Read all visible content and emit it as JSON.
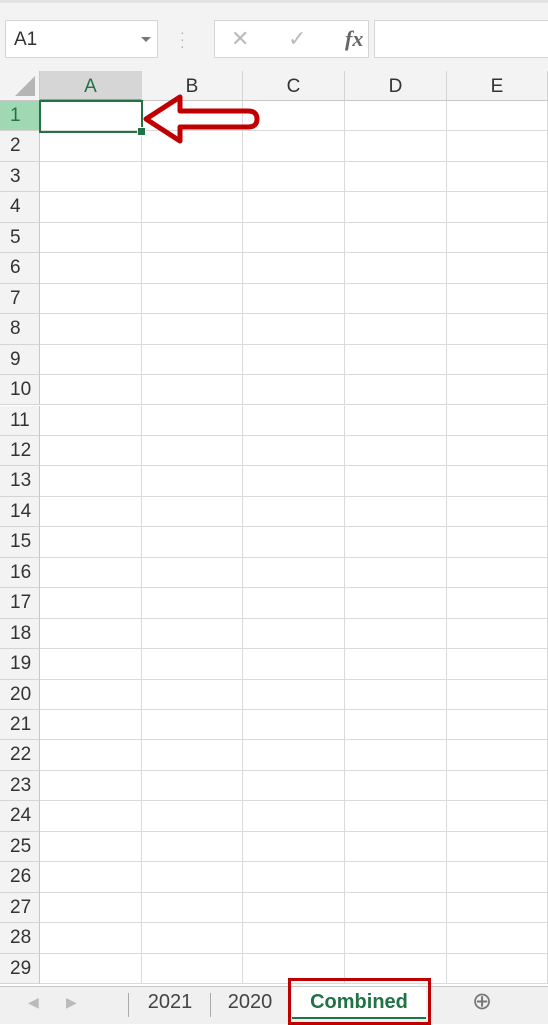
{
  "name_box": {
    "value": "A1"
  },
  "formula_bar": {
    "cancel_icon": "✕",
    "enter_icon": "✓",
    "fx_label": "fx",
    "value": ""
  },
  "columns": [
    "A",
    "B",
    "C",
    "D",
    "E"
  ],
  "rows": [
    "1",
    "2",
    "3",
    "4",
    "5",
    "6",
    "7",
    "8",
    "9",
    "10",
    "11",
    "12",
    "13",
    "14",
    "15",
    "16",
    "17",
    "18",
    "19",
    "20",
    "21",
    "22",
    "23",
    "24",
    "25",
    "26",
    "27",
    "28",
    "29"
  ],
  "selected_cell": "A1",
  "sheet_tabs": [
    {
      "label": "2021",
      "active": false
    },
    {
      "label": "2020",
      "active": false
    },
    {
      "label": "Combined",
      "active": true
    }
  ],
  "colors": {
    "accent": "#217346",
    "annotation": "#c00000"
  }
}
